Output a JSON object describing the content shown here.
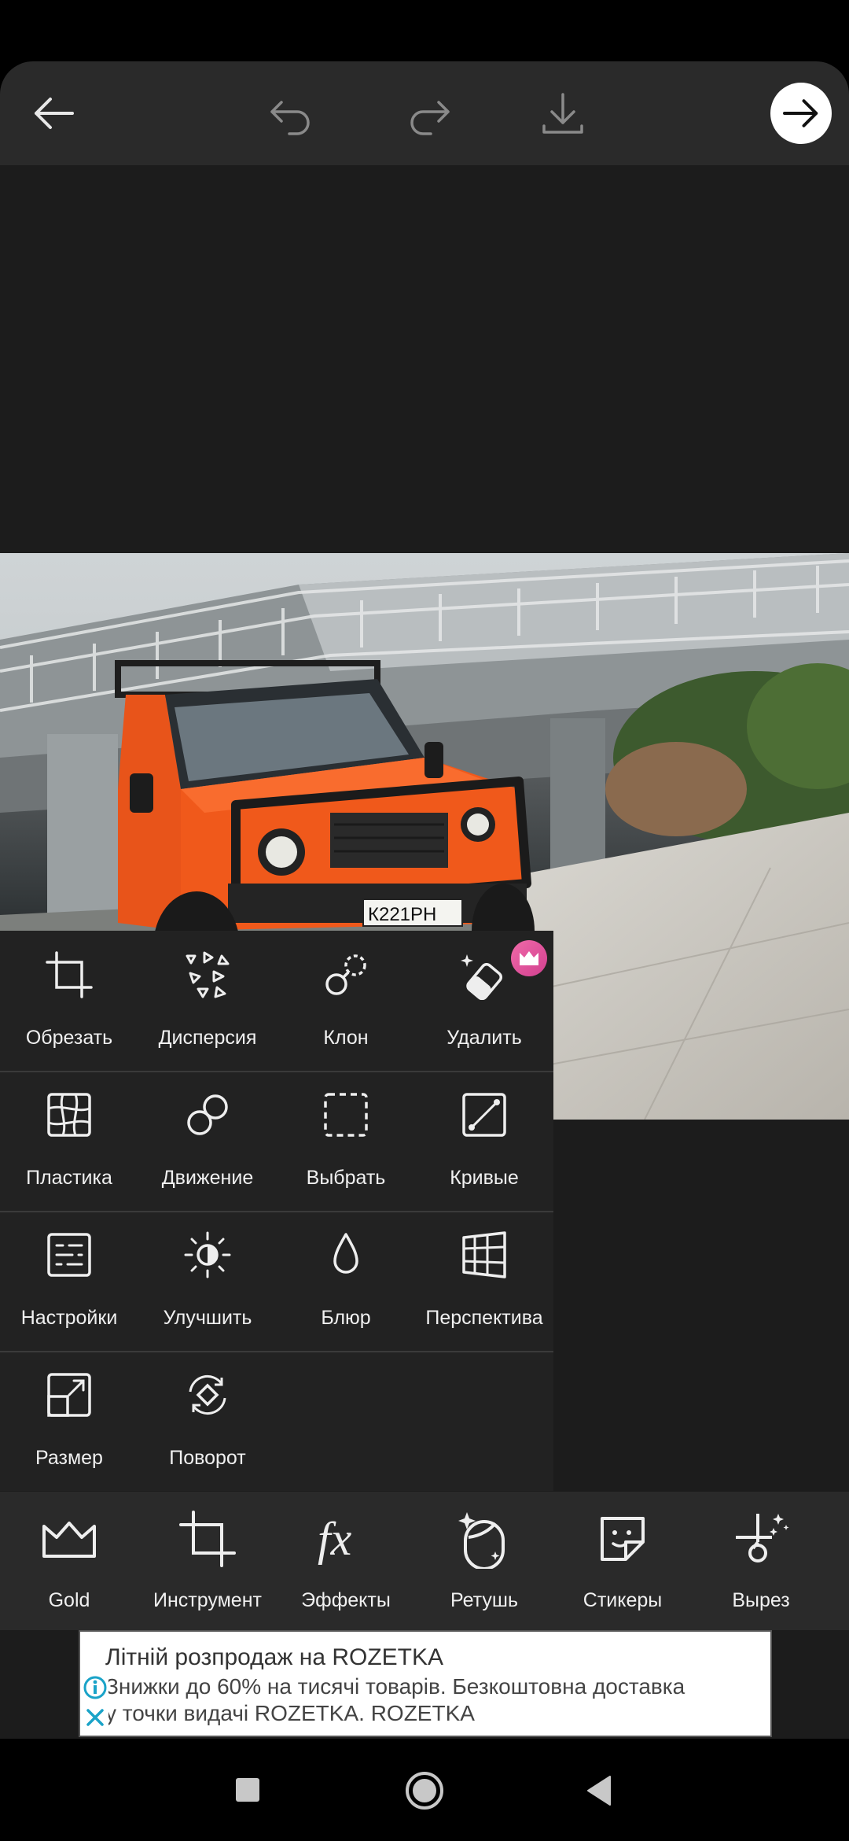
{
  "tools": {
    "row1": [
      {
        "label": "Обрезать",
        "icon": "crop-icon"
      },
      {
        "label": "Дисперсия",
        "icon": "dispersion-icon"
      },
      {
        "label": "Клон",
        "icon": "clone-icon"
      },
      {
        "label": "Удалить",
        "icon": "eraser-icon",
        "premium": true
      }
    ],
    "row2": [
      {
        "label": "Пластика",
        "icon": "warp-grid-icon"
      },
      {
        "label": "Движение",
        "icon": "motion-icon"
      },
      {
        "label": "Выбрать",
        "icon": "select-icon"
      },
      {
        "label": "Кривые",
        "icon": "curves-icon"
      }
    ],
    "row3": [
      {
        "label": "Настройки",
        "icon": "adjust-icon"
      },
      {
        "label": "Улучшить",
        "icon": "enhance-icon"
      },
      {
        "label": "Блюр",
        "icon": "blur-drop-icon"
      },
      {
        "label": "Перспектива",
        "icon": "perspective-icon"
      }
    ],
    "row4": [
      {
        "label": "Размер",
        "icon": "resize-icon"
      },
      {
        "label": "Поворот",
        "icon": "rotate-icon"
      }
    ]
  },
  "bottom_nav": [
    {
      "label": "Gold",
      "icon": "crown-icon"
    },
    {
      "label": "Инструмент",
      "icon": "tool-crop-icon"
    },
    {
      "label": "Эффекты",
      "icon": "fx-icon"
    },
    {
      "label": "Ретушь",
      "icon": "retouch-face-icon"
    },
    {
      "label": "Стикеры",
      "icon": "sticker-icon"
    },
    {
      "label": "Вырез",
      "icon": "cutout-scissors-icon"
    }
  ],
  "photo": {
    "plate": "К221РН"
  },
  "ad": {
    "title": "Літній розпродаж на ROZETKA",
    "line1": "Знижки до 60% на тисячі товарів. Безкоштовна доставка",
    "line2": "у точки видачі ROZETKA. ROZETKA"
  },
  "colors": {
    "accent": "#f25a16",
    "panel": "#222222",
    "bar": "#2a2a2a",
    "premium_badge": "#e04a9a"
  }
}
